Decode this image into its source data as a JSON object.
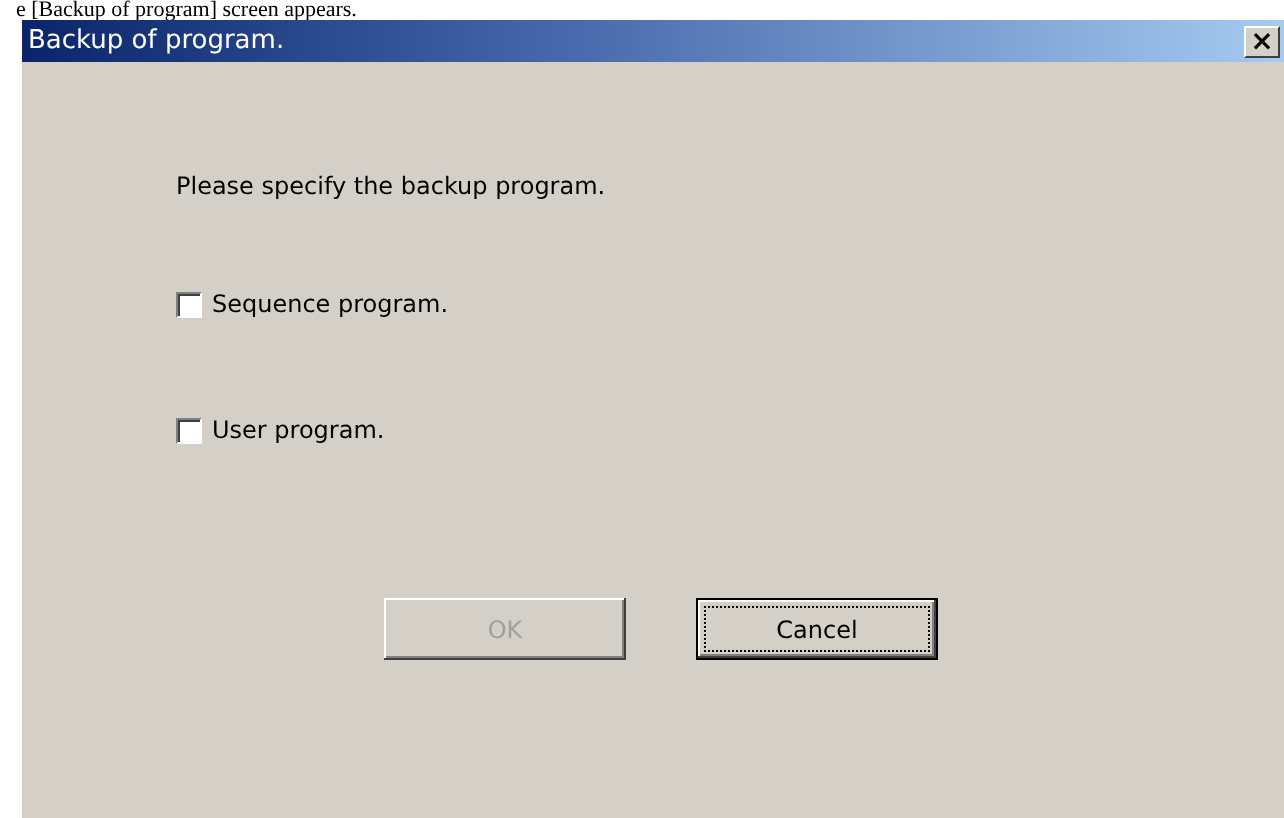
{
  "caption": "e [Backup of program] screen appears.",
  "window": {
    "title": "Backup of program.",
    "close": "×"
  },
  "prompt": "Please specify the backup program.",
  "options": [
    {
      "label": "Sequence program.",
      "checked": false
    },
    {
      "label": "User program.",
      "checked": false
    }
  ],
  "buttons": [
    {
      "label": "OK",
      "disabled": true,
      "focused": false
    },
    {
      "label": "Cancel",
      "disabled": false,
      "focused": true
    }
  ]
}
